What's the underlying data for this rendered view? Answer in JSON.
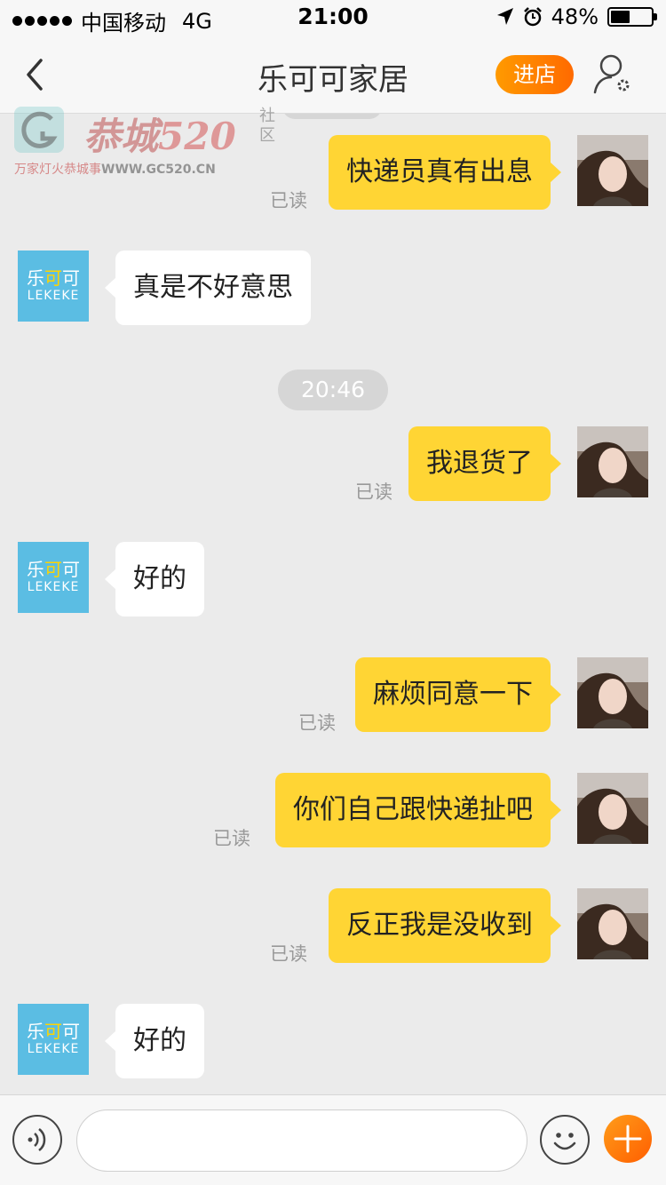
{
  "status_bar": {
    "carrier": "中国移动",
    "network": "4G",
    "time": "21:00",
    "battery_percent": "48%",
    "battery_level": 0.48
  },
  "nav": {
    "title": "乐可可家居",
    "store_button": "进店",
    "back_icon": "chevron-left-icon",
    "profile_icon": "user-settings-icon"
  },
  "watermark": {
    "brand": "恭城",
    "number": "520",
    "side": "社区",
    "tagline": "万家灯火恭城事",
    "url": "WWW.GC520.CN"
  },
  "shop_avatar": {
    "name_cn": "乐可可",
    "name_en": "LEKEKE"
  },
  "chat": {
    "timestamp": "20:46",
    "messages": [
      {
        "sender": "me",
        "text": "快递员真有出息",
        "status": "已读"
      },
      {
        "sender": "shop",
        "text": "真是不好意思"
      },
      {
        "sender": "me",
        "text": "我退货了",
        "status": "已读"
      },
      {
        "sender": "shop",
        "text": "好的"
      },
      {
        "sender": "me",
        "text": "麻烦同意一下",
        "status": "已读"
      },
      {
        "sender": "me",
        "text": "你们自己跟快递扯吧",
        "status": "已读"
      },
      {
        "sender": "me",
        "text": "反正我是没收到",
        "status": "已读"
      },
      {
        "sender": "shop",
        "text": "好的"
      }
    ]
  },
  "input_bar": {
    "placeholder": "",
    "value": "",
    "voice_icon": "voice-icon",
    "emoji_icon": "emoji-icon",
    "plus_icon": "plus-icon"
  },
  "colors": {
    "my_bubble": "#ffd534",
    "shop_bubble": "#ffffff",
    "accent": "#ff7a00",
    "shop_avatar_bg": "#5bbde3",
    "background": "#ebebeb"
  }
}
